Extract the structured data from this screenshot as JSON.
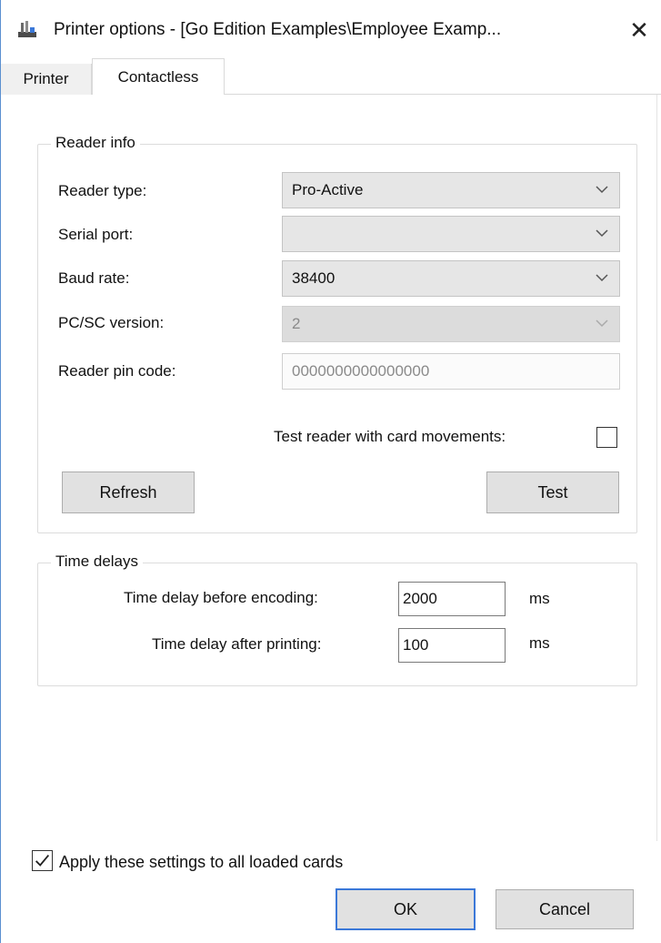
{
  "window": {
    "title": "Printer options - [Go Edition Examples\\Employee Examp...",
    "app_icon": "printer-icon",
    "close_glyph": "✕"
  },
  "tabs": [
    {
      "label": "Printer",
      "selected": false
    },
    {
      "label": "Contactless",
      "selected": true
    }
  ],
  "reader_info": {
    "group_title": "Reader info",
    "reader_type": {
      "label": "Reader type:",
      "value": "Pro-Active"
    },
    "serial_port": {
      "label": "Serial port:",
      "value": ""
    },
    "baud_rate": {
      "label": "Baud rate:",
      "value": "38400"
    },
    "pcsc_version": {
      "label": "PC/SC version:",
      "value": "2",
      "enabled": false
    },
    "pin_code": {
      "label": "Reader pin code:",
      "value": "0000000000000000",
      "enabled": false
    },
    "test_movements": {
      "label": "Test reader with card movements:",
      "checked": false
    },
    "refresh_label": "Refresh",
    "test_label": "Test"
  },
  "time_delays": {
    "group_title": "Time delays",
    "before_encoding": {
      "label": "Time delay before encoding:",
      "value": "2000",
      "unit": "ms"
    },
    "after_printing": {
      "label": "Time delay after printing:",
      "value": "100",
      "unit": "ms"
    }
  },
  "footer": {
    "apply_all": {
      "label": "Apply these settings to all loaded cards",
      "checked": true
    },
    "ok_label": "OK",
    "cancel_label": "Cancel"
  },
  "colors": {
    "accent": "#3b78d8",
    "combo_bg": "#e6e6e6",
    "button_bg": "#e1e1e1"
  }
}
